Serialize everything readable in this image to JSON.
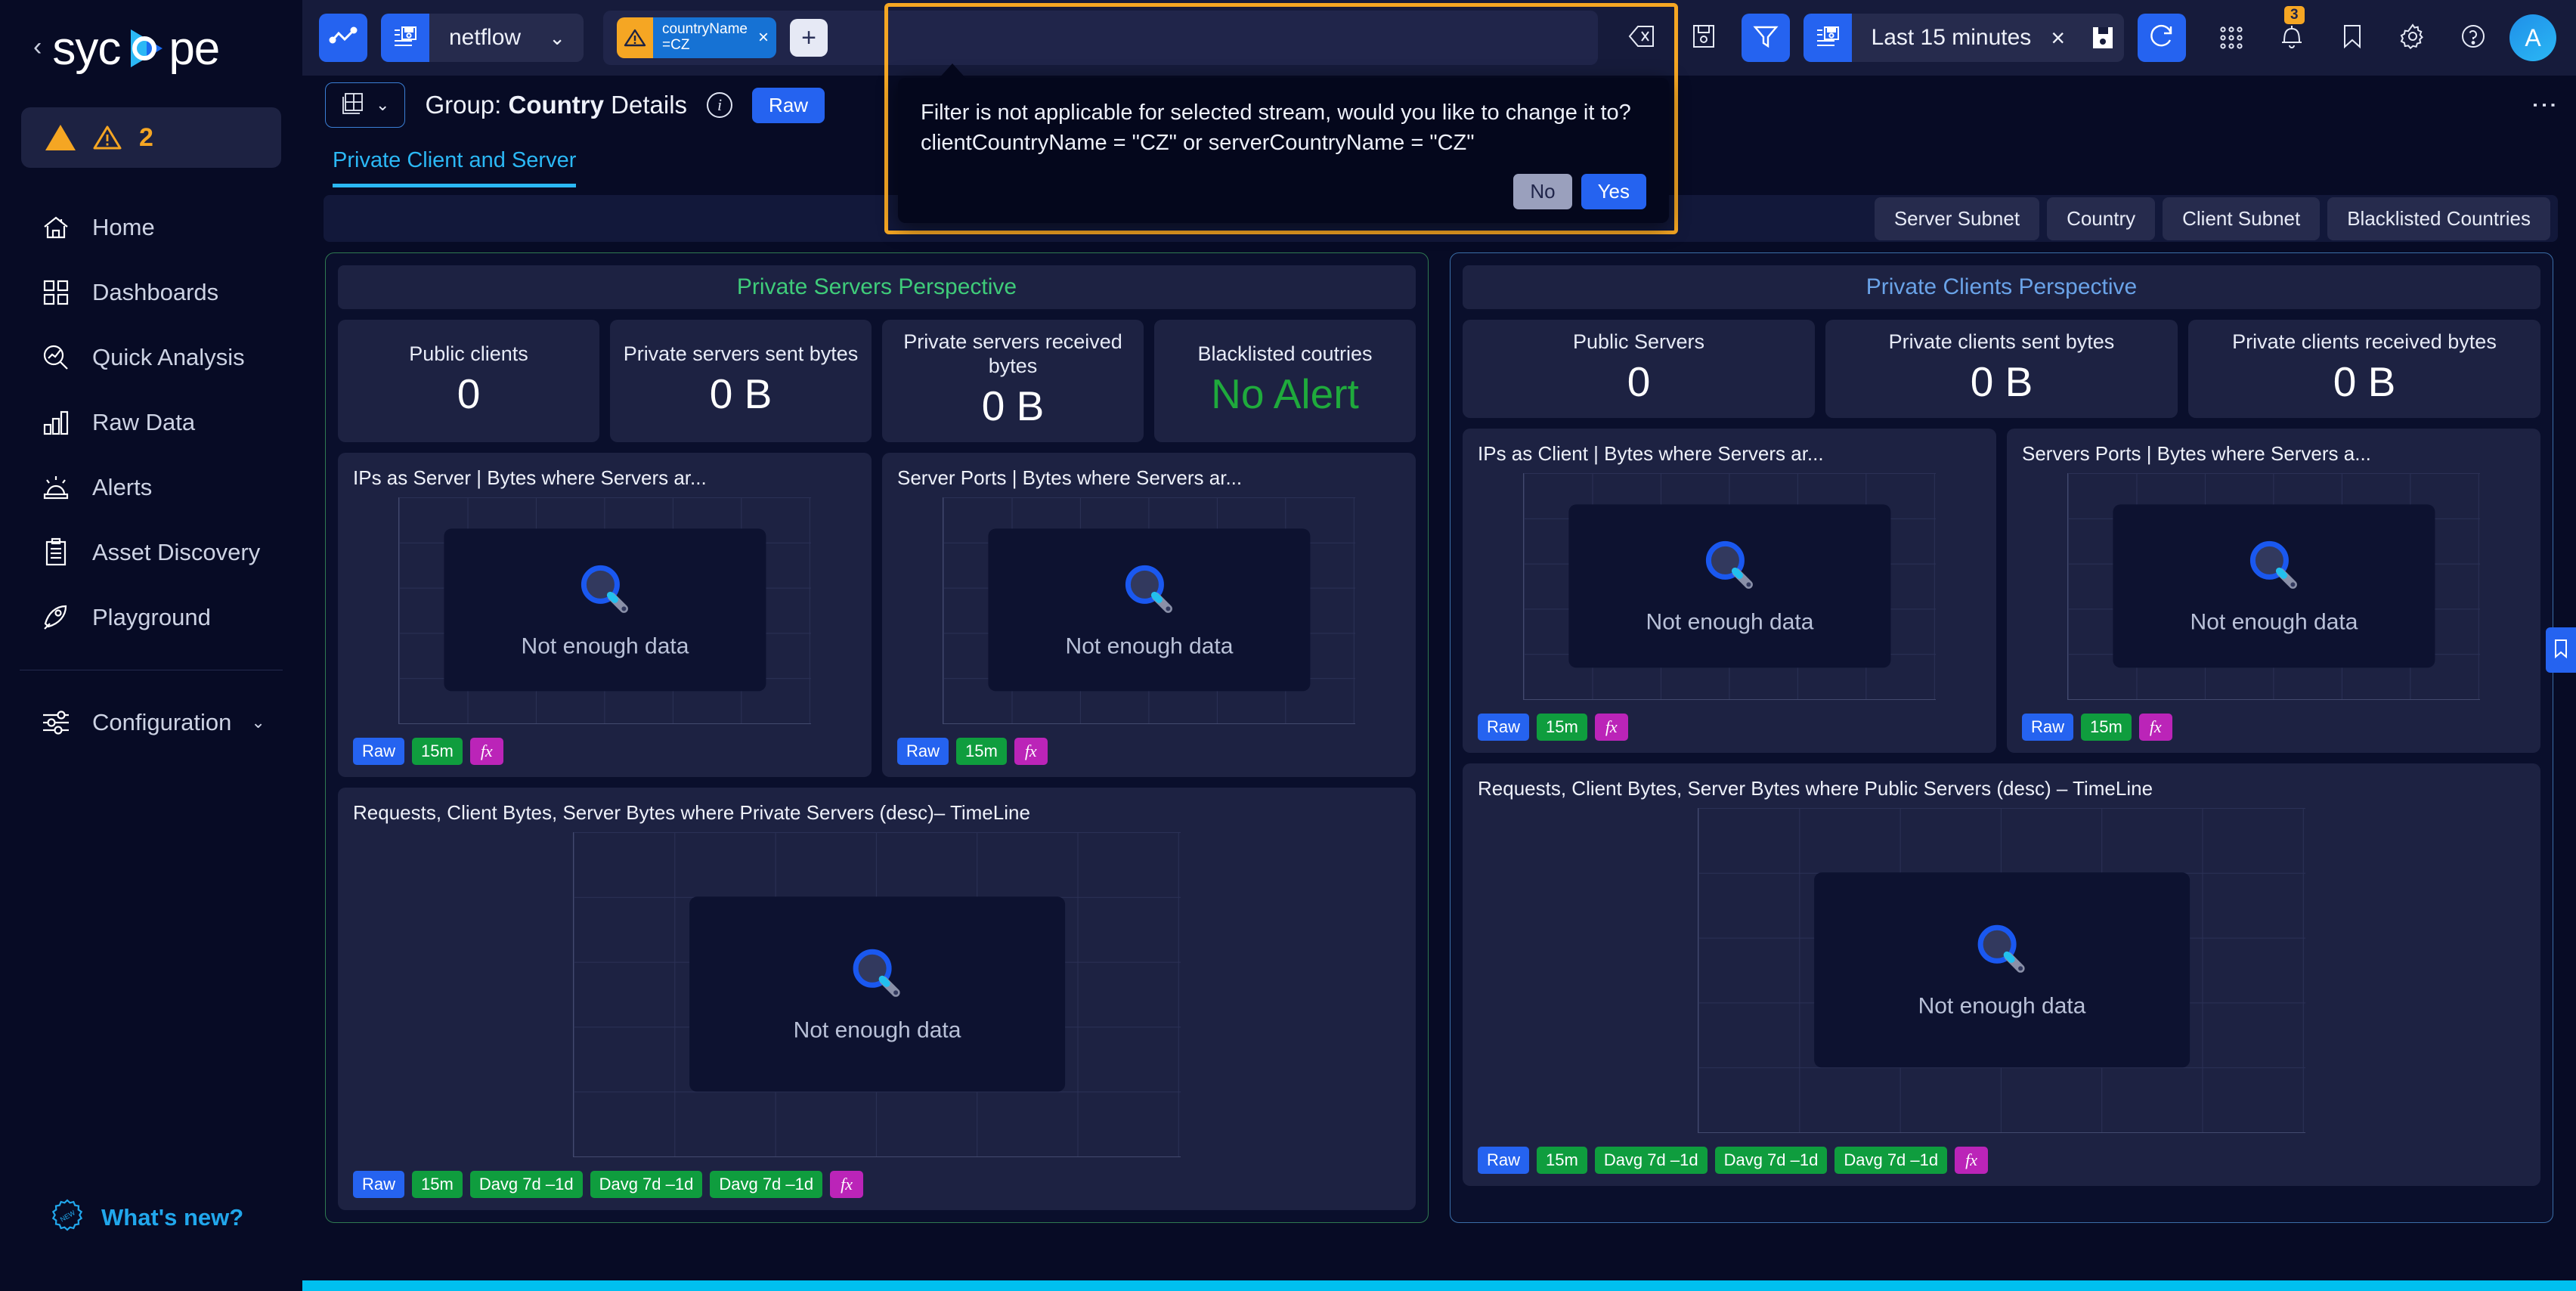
{
  "sidebar": {
    "brand": "syc pe",
    "collapse_icon": "chevron-left-icon",
    "alert_pill": {
      "count": "2",
      "icon": "warning-triangle-icon"
    },
    "items": [
      {
        "label": "Home",
        "icon": "home-icon"
      },
      {
        "label": "Dashboards",
        "icon": "grid-icon"
      },
      {
        "label": "Quick Analysis",
        "icon": "analysis-search-icon"
      },
      {
        "label": "Raw Data",
        "icon": "bar-chart-icon"
      },
      {
        "label": "Alerts",
        "icon": "siren-icon"
      },
      {
        "label": "Asset Discovery",
        "icon": "clipboard-icon"
      },
      {
        "label": "Playground",
        "icon": "rocket-icon"
      }
    ],
    "configuration": {
      "label": "Configuration",
      "icon": "sliders-icon",
      "chevron": "chevron-down-icon"
    },
    "whats_new": {
      "label": "What's new?",
      "icon": "new-badge-icon"
    }
  },
  "toolbar": {
    "pulse_icon": "activity-pulse-icon",
    "stream": {
      "icon": "stream-save-icon",
      "name": "netflow",
      "chevron": "chevron-down-icon"
    },
    "filter_chip": {
      "warn_icon": "warning-triangle-icon",
      "field": "countryName",
      "value": "=CZ",
      "close": "×"
    },
    "filter_add": "+",
    "clear_filter_icon": "clear-filter-icon",
    "save_filter_icon": "floppy-save-icon",
    "funnel_icon": "funnel-icon",
    "timerange": {
      "icon": "stream-save-icon",
      "label": "Last 15 minutes",
      "close": "×",
      "save_icon": "floppy-save-icon"
    },
    "refresh_icon": "refresh-icon",
    "apps_icon": "apps-grid-icon",
    "bell_icon": "bell-icon",
    "bell_badge": "3",
    "bookmark_icon": "bookmark-icon",
    "settings_icon": "gear-icon",
    "help_icon": "help-circle-icon",
    "avatar_initial": "A"
  },
  "title_row": {
    "group_icon": "group-tiles-icon",
    "group_chevron": "chevron-down-icon",
    "title_prefix": "Group: ",
    "title_strong": "Country",
    "title_suffix": " Details",
    "info_icon": "info-icon",
    "raw_badge": "Raw",
    "kebab_icon": "more-vertical-icon"
  },
  "tabs": {
    "active": "Private Client and Server",
    "chips": [
      "Server Subnet",
      "Country",
      "Client Subnet",
      "Blacklisted Countries"
    ]
  },
  "modal": {
    "message_line1": "Filter is not applicable for selected stream, would you like to change it to?",
    "message_line2": "clientCountryName = \"CZ\" or serverCountryName = \"CZ\"",
    "no_label": "No",
    "yes_label": "Yes"
  },
  "board": {
    "servers": {
      "header": "Private Servers Perspective",
      "accent": "#3fcc7a",
      "kpis": [
        {
          "label": "Public clients",
          "value": "0",
          "state": "normal"
        },
        {
          "label": "Private servers sent bytes",
          "value": "0 B",
          "state": "normal"
        },
        {
          "label": "Private servers received bytes",
          "value": "0 B",
          "state": "normal"
        },
        {
          "label": "Blacklisted coutries",
          "value": "No Alert",
          "state": "ok"
        }
      ],
      "panels": [
        {
          "title": "IPs as Server | Bytes where Servers ar...",
          "empty_text": "Not enough data",
          "badges": [
            {
              "text": "Raw",
              "kind": "raw"
            },
            {
              "text": "15m",
              "kind": "green"
            },
            {
              "text": "fx",
              "kind": "fx"
            }
          ]
        },
        {
          "title": "Server Ports | Bytes where Servers ar...",
          "empty_text": "Not enough data",
          "badges": [
            {
              "text": "Raw",
              "kind": "raw"
            },
            {
              "text": "15m",
              "kind": "green"
            },
            {
              "text": "fx",
              "kind": "fx"
            }
          ]
        }
      ],
      "timeline": {
        "title": "Requests, Client Bytes, Server Bytes where Private Servers (desc)– TimeLine",
        "empty_text": "Not enough data",
        "badges": [
          {
            "text": "Raw",
            "kind": "raw"
          },
          {
            "text": "15m",
            "kind": "green"
          },
          {
            "text": "Davg 7d –1d",
            "kind": "green"
          },
          {
            "text": "Davg 7d –1d",
            "kind": "green"
          },
          {
            "text": "Davg 7d –1d",
            "kind": "green"
          },
          {
            "text": "fx",
            "kind": "fx"
          }
        ]
      }
    },
    "clients": {
      "header": "Private Clients Perspective",
      "accent": "#6aa3e8",
      "kpis": [
        {
          "label": "Public Servers",
          "value": "0",
          "state": "normal"
        },
        {
          "label": "Private clients sent bytes",
          "value": "0 B",
          "state": "normal"
        },
        {
          "label": "Private clients received bytes",
          "value": "0 B",
          "state": "normal"
        }
      ],
      "panels": [
        {
          "title": "IPs as Client | Bytes where Servers ar...",
          "empty_text": "Not enough data",
          "badges": [
            {
              "text": "Raw",
              "kind": "raw"
            },
            {
              "text": "15m",
              "kind": "green"
            },
            {
              "text": "fx",
              "kind": "fx"
            }
          ]
        },
        {
          "title": "Servers Ports | Bytes where Servers a...",
          "empty_text": "Not enough data",
          "badges": [
            {
              "text": "Raw",
              "kind": "raw"
            },
            {
              "text": "15m",
              "kind": "green"
            },
            {
              "text": "fx",
              "kind": "fx"
            }
          ]
        }
      ],
      "timeline": {
        "title": "Requests, Client Bytes, Server Bytes where Public Servers (desc) – TimeLine",
        "empty_text": "Not enough data",
        "badges": [
          {
            "text": "Raw",
            "kind": "raw"
          },
          {
            "text": "15m",
            "kind": "green"
          },
          {
            "text": "Davg 7d –1d",
            "kind": "green"
          },
          {
            "text": "Davg 7d –1d",
            "kind": "green"
          },
          {
            "text": "Davg 7d –1d",
            "kind": "green"
          },
          {
            "text": "fx",
            "kind": "fx"
          }
        ]
      }
    }
  },
  "edge_tab_icon": "bookmark-icon"
}
